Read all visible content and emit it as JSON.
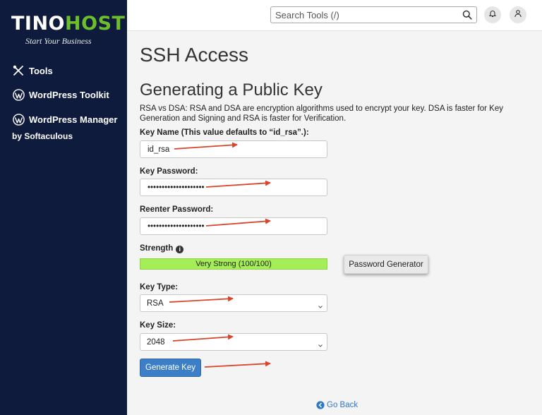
{
  "brand": {
    "name_part1": "TINO",
    "name_part2": "HOST",
    "tagline": "Start Your Business",
    "accent": "#6cbf2b"
  },
  "sidebar": {
    "items": [
      {
        "label": "Tools",
        "icon": "tools-icon"
      },
      {
        "label": "WordPress Toolkit",
        "icon": "wordpress-icon"
      },
      {
        "label": "WordPress Manager",
        "icon": "wordpress-icon"
      }
    ],
    "sub_label": "by Softaculous"
  },
  "topbar": {
    "search_placeholder": "Search Tools (/)",
    "icons": [
      "search-icon",
      "bell-icon",
      "user-icon"
    ]
  },
  "page": {
    "title": "SSH Access",
    "section_title": "Generating a Public Key",
    "description": "RSA vs DSA: RSA and DSA are encryption algorithms used to encrypt your key. DSA is faster for Key Generation and Signing and RSA is faster for Verification."
  },
  "form": {
    "key_name_label": "Key Name (This value defaults to “id_rsa”.):",
    "key_name_value": "id_rsa",
    "password_label": "Key Password:",
    "password_value": "••••••••••••••••••••",
    "reenter_label": "Reenter Password:",
    "reenter_value": "••••••••••••••••••••",
    "strength_label": "Strength",
    "strength_text": "Very Strong (100/100)",
    "strength_value": 100,
    "password_generator_label": "Password Generator",
    "key_type_label": "Key Type:",
    "key_type_value": "RSA",
    "key_size_label": "Key Size:",
    "key_size_value": "2048",
    "generate_label": "Generate Key"
  },
  "footer": {
    "go_back_label": "Go Back"
  },
  "colors": {
    "sidebar_bg": "#0f1b3d",
    "primary_button": "#3d7fc7",
    "strength_bar": "#a6ee57",
    "annotation_arrow": "#d9452b"
  }
}
